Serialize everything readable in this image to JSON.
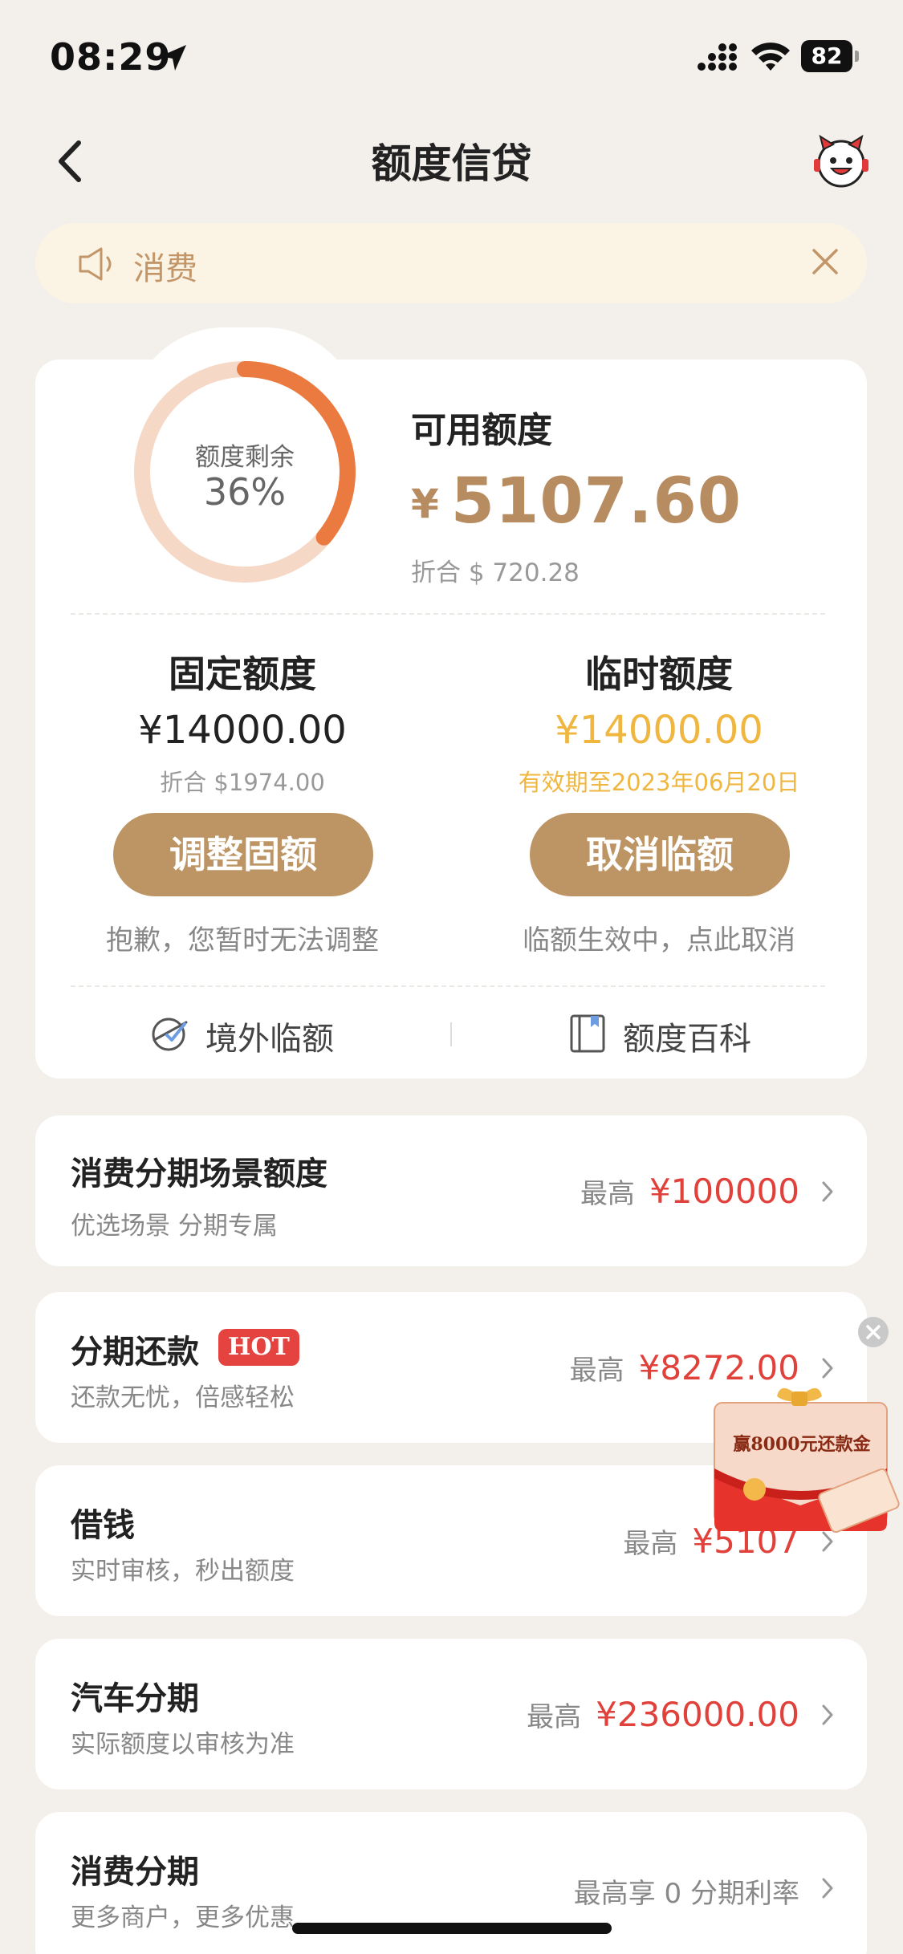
{
  "status_bar": {
    "time": "08:29",
    "battery": "82"
  },
  "nav": {
    "title": "额度信贷"
  },
  "notice": {
    "text": "消费"
  },
  "credit": {
    "gauge_label": "额度剩余",
    "gauge_percent_text": "36%",
    "remaining_fraction": 0.36,
    "available_label": "可用额度",
    "currency_symbol": "¥",
    "available_amount": "5107.60",
    "available_usd": "折合 $ 720.28",
    "fixed": {
      "title": "固定额度",
      "amount": "¥14000.00",
      "sub": "折合 $1974.00",
      "button": "调整固额",
      "note": "抱歉，您暂时无法调整"
    },
    "temp": {
      "title": "临时额度",
      "amount": "¥14000.00",
      "sub": "有效期至2023年06月20日",
      "button": "取消临额",
      "note": "临额生效中，点此取消"
    },
    "links": [
      {
        "label": "境外临额",
        "icon": "overseas-limit-icon"
      },
      {
        "label": "额度百科",
        "icon": "book-icon"
      }
    ]
  },
  "list": [
    {
      "title": "消费分期场景额度",
      "sub": "优选场景 分期专属",
      "prefix": "最高",
      "amount": "¥100000"
    },
    {
      "title": "分期还款",
      "badge": "HOT",
      "sub": "还款无忧，倍感轻松",
      "prefix": "最高",
      "amount": "¥8272.00"
    },
    {
      "title": "借钱",
      "sub": "实时审核，秒出额度",
      "prefix": "最高",
      "amount": "¥5107"
    },
    {
      "title": "汽车分期",
      "sub": "实际额度以审核为准",
      "prefix": "最高",
      "amount": "¥236000.00"
    },
    {
      "title": "消费分期",
      "sub": "更多商户，更多优惠",
      "right_text": "最高享 0 分期利率"
    }
  ],
  "promo": {
    "text": "赢8000元还款金"
  },
  "colors": {
    "background": "#f3efea",
    "gold": "#b68c60",
    "button_gold": "#bd9565",
    "orange_arc": "#ea7a40",
    "light_arc": "#f6d8c6",
    "temp_orange": "#efb640",
    "red_amount": "#e0413a",
    "notice_bg": "#fbf4e4"
  }
}
